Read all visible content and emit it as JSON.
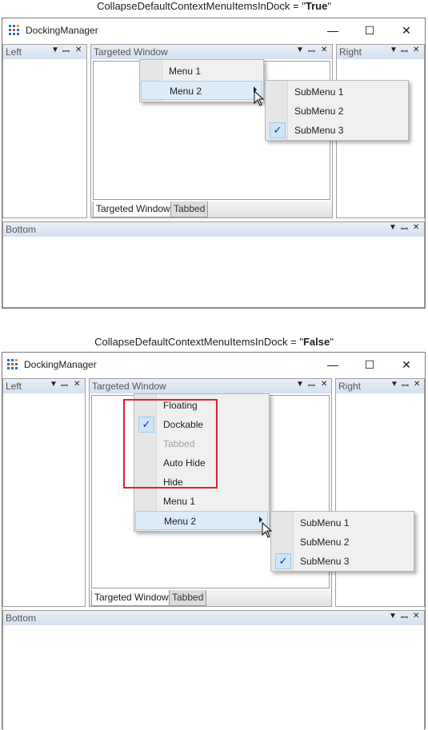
{
  "caption_top": {
    "prefix": "CollapseDefaultContextMenuItemsInDock = \"",
    "value": "True",
    "suffix": "\""
  },
  "caption_bottom": {
    "prefix": "CollapseDefaultContextMenuItemsInDock = \"",
    "value": "False",
    "suffix": "\""
  },
  "window": {
    "title": "DockingManager",
    "minimize_glyph": "—",
    "maximize_glyph": "☐",
    "close_glyph": "✕",
    "icon": "grid-app-icon"
  },
  "panel_controls": {
    "dropdown": "▼",
    "pin": "📌",
    "close": "✕"
  },
  "panels": {
    "left": "Left",
    "targeted": "Targeted Window",
    "right": "Right",
    "bottom": "Bottom"
  },
  "tabs": [
    "Targeted Window",
    "Tabbed"
  ],
  "menu_top": {
    "items": [
      "Menu 1",
      "Menu 2"
    ]
  },
  "menu_bottom": {
    "default_items": [
      {
        "label": "Floating",
        "checked": false,
        "disabled": false
      },
      {
        "label": "Dockable",
        "checked": true,
        "disabled": false
      },
      {
        "label": "Tabbed",
        "checked": false,
        "disabled": true
      },
      {
        "label": "Auto Hide",
        "checked": false,
        "disabled": false
      },
      {
        "label": "Hide",
        "checked": false,
        "disabled": false
      }
    ],
    "items": [
      "Menu 1",
      "Menu 2"
    ]
  },
  "submenu": {
    "items": [
      "SubMenu 1",
      "SubMenu 2",
      "SubMenu 3"
    ],
    "checked_item": "SubMenu 3"
  },
  "check_glyph": "✓",
  "colors": {
    "highlight_border": "#d9232f",
    "panel_header": "#d4e0ef"
  }
}
